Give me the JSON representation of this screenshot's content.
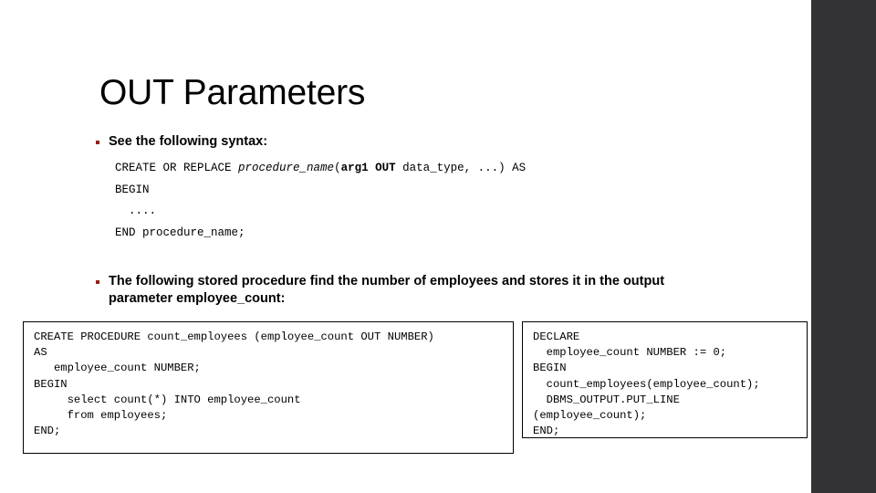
{
  "slide": {
    "title": "OUT Parameters",
    "background_color": "#ffffff",
    "accent_band_color": "#333336",
    "bullet_color": "#8c2318"
  },
  "bullets": [
    {
      "id": "syntax",
      "text": "See the following syntax:"
    },
    {
      "id": "description",
      "text": "The following stored procedure find the number of employees and stores it in the output parameter employee_count:"
    }
  ],
  "syntax_block": {
    "line1_prefix": "CREATE OR REPLACE ",
    "line1_italic": "procedure_name",
    "line1_paren_open": "(",
    "line1_bold": "arg1 OUT",
    "line1_suffix": " data_type, ...) AS",
    "line2": "BEGIN",
    "line3": "  ....",
    "line4": "END procedure_name;"
  },
  "code_box_left": {
    "code": "CREATE PROCEDURE count_employees (employee_count OUT NUMBER)\nAS\n   employee_count NUMBER;\nBEGIN\n     select count(*) INTO employee_count\n     from employees;\nEND;"
  },
  "code_box_right": {
    "code": "DECLARE\n  employee_count NUMBER := 0;\nBEGIN\n  count_employees(employee_count);\n  DBMS_OUTPUT.PUT_LINE\n(employee_count);\nEND;"
  }
}
